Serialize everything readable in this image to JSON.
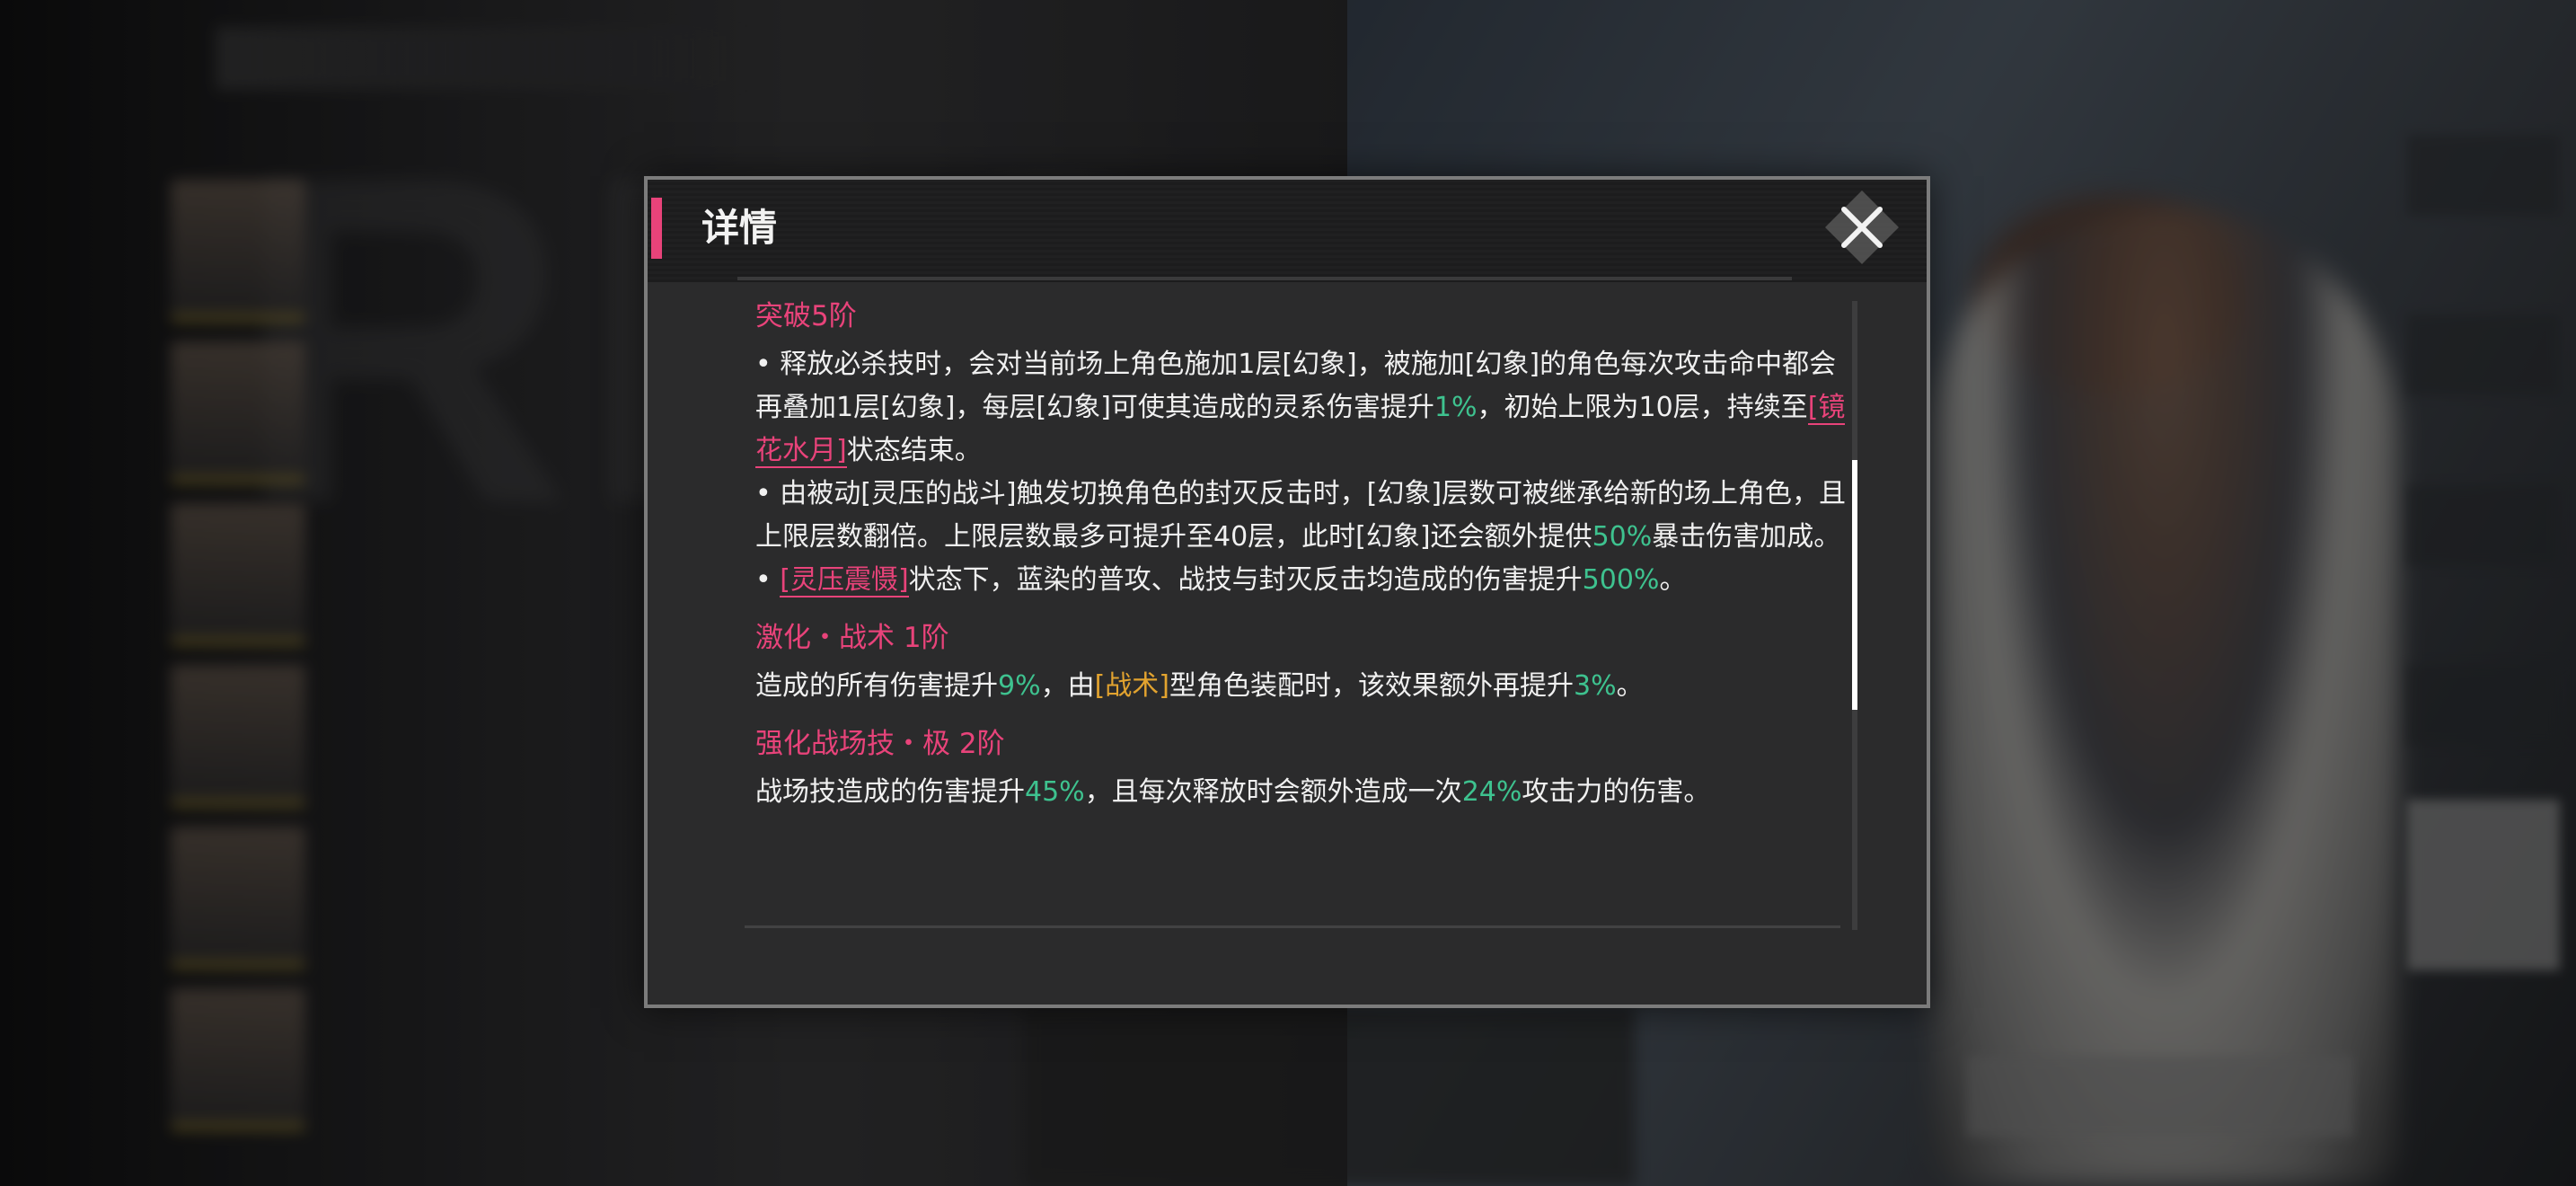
{
  "dialog": {
    "title": "详情",
    "close_label": "关闭"
  },
  "sections": [
    {
      "title": "突破5阶",
      "paragraphs": [
        [
          {
            "t": "• 释放必杀技时，会对当前场上角色施加1层[幻象]，被施加[幻象]的角色每次攻击命中都会再叠加1层[幻象]，每层[幻象]可使其造成的灵系伤害提升",
            "s": "n"
          },
          {
            "t": "1%",
            "s": "hl"
          },
          {
            "t": "，初始上限为10层，持续至",
            "s": "n"
          },
          {
            "t": "[镜花水月]",
            "s": "tag"
          },
          {
            "t": "状态结束。",
            "s": "n"
          }
        ],
        [
          {
            "t": "• 由被动[灵压的战斗]触发切换角色的封灭反击时，[幻象]层数可被继承给新的场上角色，且上限层数翻倍。上限层数最多可提升至40层，此时[幻象]还会额外提供",
            "s": "n"
          },
          {
            "t": "50%",
            "s": "hl"
          },
          {
            "t": "暴击伤害加成。",
            "s": "n"
          }
        ],
        [
          {
            "t": "• ",
            "s": "n"
          },
          {
            "t": "[灵压震慑]",
            "s": "tag"
          },
          {
            "t": "状态下，蓝染的普攻、战技与封灭反击均造成的伤害提升",
            "s": "n"
          },
          {
            "t": "500%",
            "s": "hl"
          },
          {
            "t": "。",
            "s": "n"
          }
        ]
      ]
    },
    {
      "title": "激化・战术 1阶",
      "paragraphs": [
        [
          {
            "t": "造成的所有伤害提升",
            "s": "n"
          },
          {
            "t": "9%",
            "s": "hl"
          },
          {
            "t": "，由",
            "s": "n"
          },
          {
            "t": "[战术]",
            "s": "gold"
          },
          {
            "t": "型角色装配时，该效果额外再提升",
            "s": "n"
          },
          {
            "t": "3%",
            "s": "hl"
          },
          {
            "t": "。",
            "s": "n"
          }
        ]
      ]
    },
    {
      "title": "强化战场技・极 2阶",
      "paragraphs": [
        [
          {
            "t": "战场技造成的伤害提升",
            "s": "n"
          },
          {
            "t": "45%",
            "s": "hl"
          },
          {
            "t": "，且每次释放时会额外造成一次",
            "s": "n"
          },
          {
            "t": "24%",
            "s": "hl"
          },
          {
            "t": "攻击力的伤害。",
            "s": "n"
          }
        ]
      ]
    }
  ],
  "colors": {
    "accent": "#e8437a",
    "highlight": "#3ec28f",
    "tactic": "#e2a32f",
    "text": "#f0f0f0"
  },
  "scroll": {
    "position": 0.42
  }
}
